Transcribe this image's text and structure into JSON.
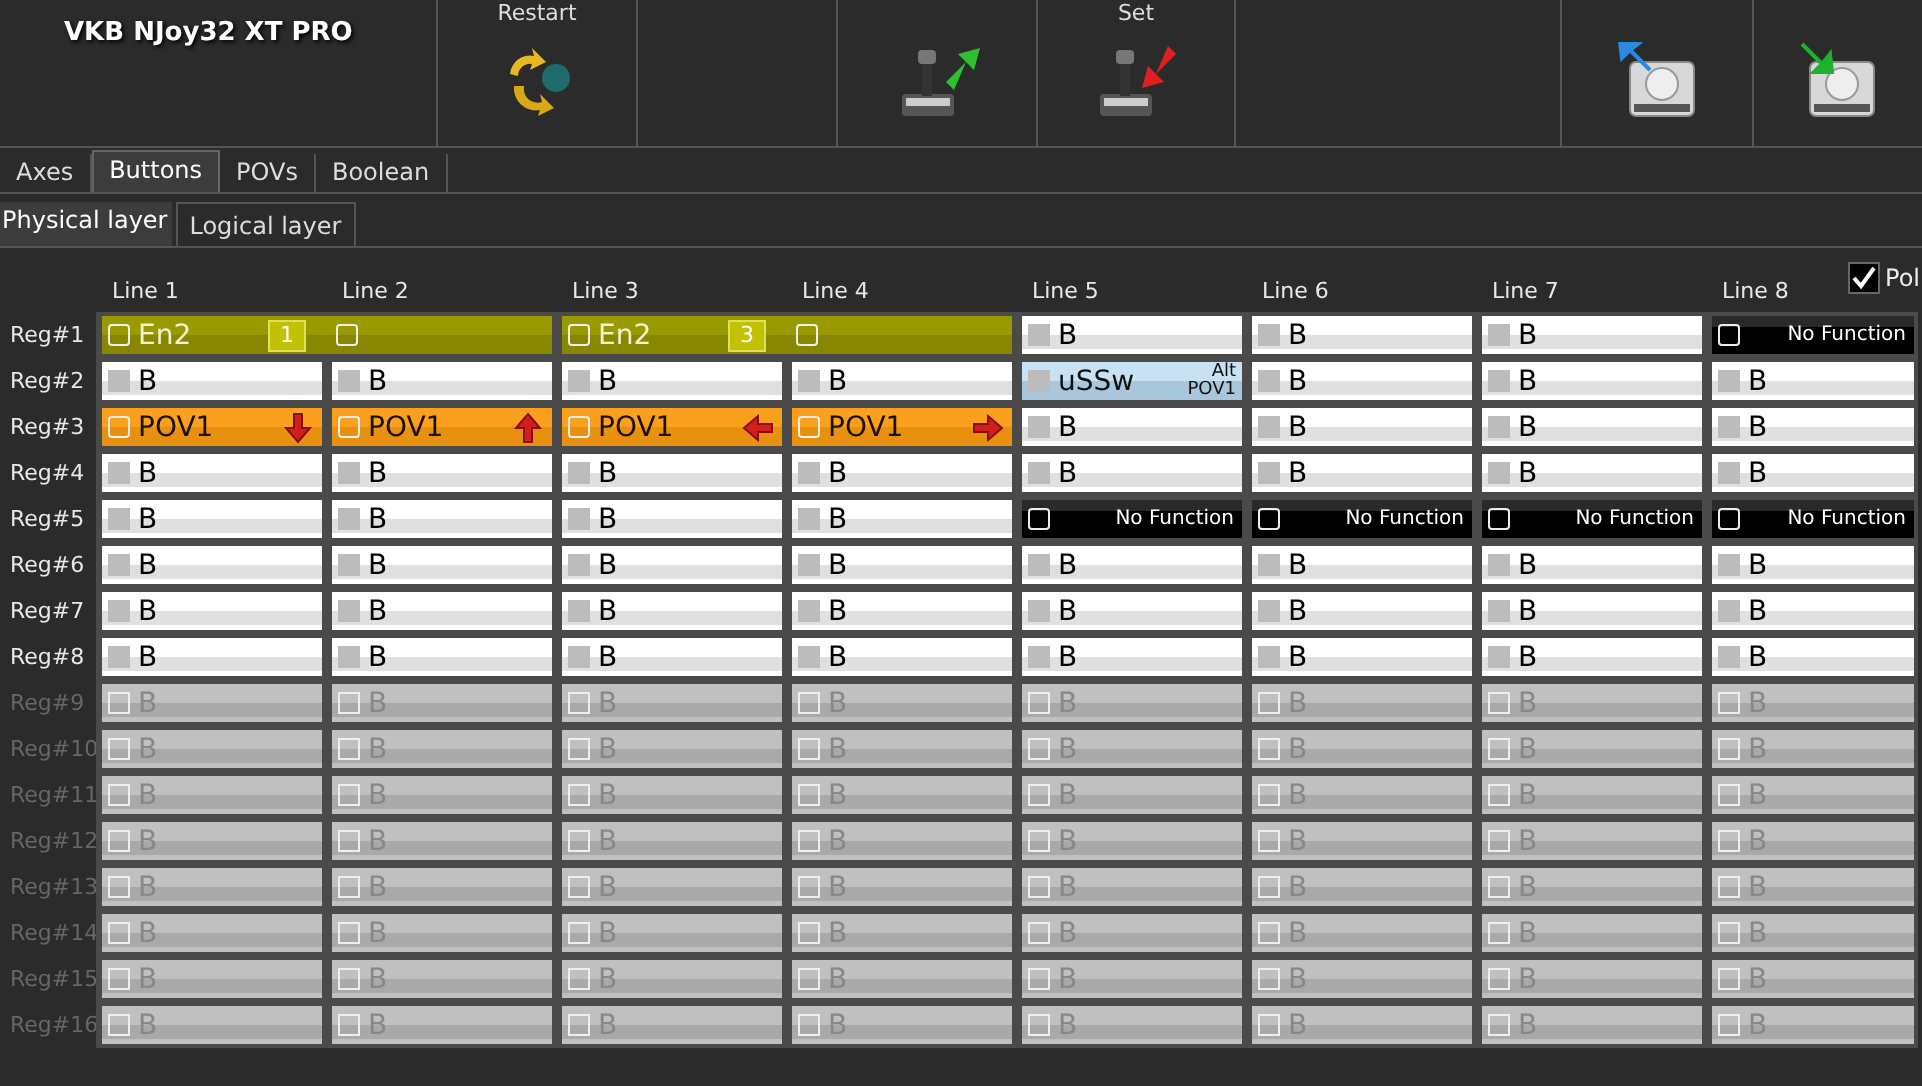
{
  "app": {
    "title": "VKB NJoy32 XT PRO"
  },
  "toolbar": [
    {
      "kind": "restart",
      "label": "Restart"
    },
    {
      "kind": "empty"
    },
    {
      "kind": "joystick_up"
    },
    {
      "kind": "joystick_down",
      "label": "Set"
    },
    {
      "kind": "empty_wide"
    },
    {
      "kind": "disk_up"
    },
    {
      "kind": "disk_down"
    }
  ],
  "tabs": [
    {
      "label": "Axes",
      "selected": false
    },
    {
      "label": "Buttons",
      "selected": true
    },
    {
      "label": "POVs",
      "selected": false
    },
    {
      "label": "Boolean",
      "selected": false
    }
  ],
  "layer_tabs": [
    {
      "label": "Physical layer",
      "selected": true
    },
    {
      "label": "Logical layer",
      "selected": false
    }
  ],
  "pol_checkbox": {
    "label": "Pol",
    "checked": true
  },
  "grid": {
    "columns": [
      "Line 1",
      "Line 2",
      "Line 3",
      "Line 4",
      "Line 5",
      "Line 6",
      "Line 7",
      "Line 8"
    ],
    "rows": [
      {
        "label": "Reg#1",
        "disabled": false,
        "cells": [
          {
            "kind": "group",
            "label": "En2",
            "badge": "1"
          },
          {
            "kind": "group_tail"
          },
          {
            "kind": "group",
            "label": "En2",
            "badge": "3"
          },
          {
            "kind": "group_tail"
          },
          {
            "kind": "button",
            "label": "B"
          },
          {
            "kind": "button",
            "label": "B"
          },
          {
            "kind": "button",
            "label": "B"
          },
          {
            "kind": "none",
            "label": "No Function"
          }
        ]
      },
      {
        "label": "Reg#2",
        "disabled": false,
        "cells": [
          {
            "kind": "button",
            "label": "B"
          },
          {
            "kind": "button",
            "label": "B"
          },
          {
            "kind": "button",
            "label": "B"
          },
          {
            "kind": "button",
            "label": "B"
          },
          {
            "kind": "alt",
            "label": "uSSw",
            "tag_top": "Alt",
            "tag_bottom": "POV1"
          },
          {
            "kind": "button",
            "label": "B"
          },
          {
            "kind": "button",
            "label": "B"
          },
          {
            "kind": "button",
            "label": "B"
          }
        ]
      },
      {
        "label": "Reg#3",
        "disabled": false,
        "cells": [
          {
            "kind": "pov_down",
            "label": "POV1"
          },
          {
            "kind": "pov_up",
            "label": "POV1"
          },
          {
            "kind": "pov_left",
            "label": "POV1"
          },
          {
            "kind": "pov_right",
            "label": "POV1"
          },
          {
            "kind": "button",
            "label": "B"
          },
          {
            "kind": "button",
            "label": "B"
          },
          {
            "kind": "button",
            "label": "B"
          },
          {
            "kind": "button",
            "label": "B"
          }
        ]
      },
      {
        "label": "Reg#4",
        "disabled": false,
        "cells": [
          {
            "kind": "button",
            "label": "B"
          },
          {
            "kind": "button",
            "label": "B"
          },
          {
            "kind": "button",
            "label": "B"
          },
          {
            "kind": "button",
            "label": "B"
          },
          {
            "kind": "button",
            "label": "B"
          },
          {
            "kind": "button",
            "label": "B"
          },
          {
            "kind": "button",
            "label": "B"
          },
          {
            "kind": "button",
            "label": "B"
          }
        ]
      },
      {
        "label": "Reg#5",
        "disabled": false,
        "cells": [
          {
            "kind": "button",
            "label": "B"
          },
          {
            "kind": "button",
            "label": "B"
          },
          {
            "kind": "button",
            "label": "B"
          },
          {
            "kind": "button",
            "label": "B"
          },
          {
            "kind": "none",
            "label": "No Function"
          },
          {
            "kind": "none",
            "label": "No Function"
          },
          {
            "kind": "none",
            "label": "No Function"
          },
          {
            "kind": "none",
            "label": "No Function"
          }
        ]
      },
      {
        "label": "Reg#6",
        "disabled": false,
        "cells": [
          {
            "kind": "button",
            "label": "B"
          },
          {
            "kind": "button",
            "label": "B"
          },
          {
            "kind": "button",
            "label": "B"
          },
          {
            "kind": "button",
            "label": "B"
          },
          {
            "kind": "button",
            "label": "B"
          },
          {
            "kind": "button",
            "label": "B"
          },
          {
            "kind": "button",
            "label": "B"
          },
          {
            "kind": "button",
            "label": "B"
          }
        ]
      },
      {
        "label": "Reg#7",
        "disabled": false,
        "cells": [
          {
            "kind": "button",
            "label": "B"
          },
          {
            "kind": "button",
            "label": "B"
          },
          {
            "kind": "button",
            "label": "B"
          },
          {
            "kind": "button",
            "label": "B"
          },
          {
            "kind": "button",
            "label": "B"
          },
          {
            "kind": "button",
            "label": "B"
          },
          {
            "kind": "button",
            "label": "B"
          },
          {
            "kind": "button",
            "label": "B"
          }
        ]
      },
      {
        "label": "Reg#8",
        "disabled": false,
        "cells": [
          {
            "kind": "button",
            "label": "B"
          },
          {
            "kind": "button",
            "label": "B"
          },
          {
            "kind": "button",
            "label": "B"
          },
          {
            "kind": "button",
            "label": "B"
          },
          {
            "kind": "button",
            "label": "B"
          },
          {
            "kind": "button",
            "label": "B"
          },
          {
            "kind": "button",
            "label": "B"
          },
          {
            "kind": "button",
            "label": "B"
          }
        ]
      },
      {
        "label": "Reg#9",
        "disabled": true,
        "cells": [
          {
            "kind": "button",
            "label": "B"
          },
          {
            "kind": "button",
            "label": "B"
          },
          {
            "kind": "button",
            "label": "B"
          },
          {
            "kind": "button",
            "label": "B"
          },
          {
            "kind": "button",
            "label": "B"
          },
          {
            "kind": "button",
            "label": "B"
          },
          {
            "kind": "button",
            "label": "B"
          },
          {
            "kind": "button",
            "label": "B"
          }
        ]
      },
      {
        "label": "Reg#10",
        "disabled": true,
        "cells": [
          {
            "kind": "button",
            "label": "B"
          },
          {
            "kind": "button",
            "label": "B"
          },
          {
            "kind": "button",
            "label": "B"
          },
          {
            "kind": "button",
            "label": "B"
          },
          {
            "kind": "button",
            "label": "B"
          },
          {
            "kind": "button",
            "label": "B"
          },
          {
            "kind": "button",
            "label": "B"
          },
          {
            "kind": "button",
            "label": "B"
          }
        ]
      },
      {
        "label": "Reg#11",
        "disabled": true,
        "cells": [
          {
            "kind": "button",
            "label": "B"
          },
          {
            "kind": "button",
            "label": "B"
          },
          {
            "kind": "button",
            "label": "B"
          },
          {
            "kind": "button",
            "label": "B"
          },
          {
            "kind": "button",
            "label": "B"
          },
          {
            "kind": "button",
            "label": "B"
          },
          {
            "kind": "button",
            "label": "B"
          },
          {
            "kind": "button",
            "label": "B"
          }
        ]
      },
      {
        "label": "Reg#12",
        "disabled": true,
        "cells": [
          {
            "kind": "button",
            "label": "B"
          },
          {
            "kind": "button",
            "label": "B"
          },
          {
            "kind": "button",
            "label": "B"
          },
          {
            "kind": "button",
            "label": "B"
          },
          {
            "kind": "button",
            "label": "B"
          },
          {
            "kind": "button",
            "label": "B"
          },
          {
            "kind": "button",
            "label": "B"
          },
          {
            "kind": "button",
            "label": "B"
          }
        ]
      },
      {
        "label": "Reg#13",
        "disabled": true,
        "cells": [
          {
            "kind": "button",
            "label": "B"
          },
          {
            "kind": "button",
            "label": "B"
          },
          {
            "kind": "button",
            "label": "B"
          },
          {
            "kind": "button",
            "label": "B"
          },
          {
            "kind": "button",
            "label": "B"
          },
          {
            "kind": "button",
            "label": "B"
          },
          {
            "kind": "button",
            "label": "B"
          },
          {
            "kind": "button",
            "label": "B"
          }
        ]
      },
      {
        "label": "Reg#14",
        "disabled": true,
        "cells": [
          {
            "kind": "button",
            "label": "B"
          },
          {
            "kind": "button",
            "label": "B"
          },
          {
            "kind": "button",
            "label": "B"
          },
          {
            "kind": "button",
            "label": "B"
          },
          {
            "kind": "button",
            "label": "B"
          },
          {
            "kind": "button",
            "label": "B"
          },
          {
            "kind": "button",
            "label": "B"
          },
          {
            "kind": "button",
            "label": "B"
          }
        ]
      },
      {
        "label": "Reg#15",
        "disabled": true,
        "cells": [
          {
            "kind": "button",
            "label": "B"
          },
          {
            "kind": "button",
            "label": "B"
          },
          {
            "kind": "button",
            "label": "B"
          },
          {
            "kind": "button",
            "label": "B"
          },
          {
            "kind": "button",
            "label": "B"
          },
          {
            "kind": "button",
            "label": "B"
          },
          {
            "kind": "button",
            "label": "B"
          },
          {
            "kind": "button",
            "label": "B"
          }
        ]
      },
      {
        "label": "Reg#16",
        "disabled": true,
        "cells": [
          {
            "kind": "button",
            "label": "B"
          },
          {
            "kind": "button",
            "label": "B"
          },
          {
            "kind": "button",
            "label": "B"
          },
          {
            "kind": "button",
            "label": "B"
          },
          {
            "kind": "button",
            "label": "B"
          },
          {
            "kind": "button",
            "label": "B"
          },
          {
            "kind": "button",
            "label": "B"
          },
          {
            "kind": "button",
            "label": "B"
          }
        ]
      }
    ]
  }
}
